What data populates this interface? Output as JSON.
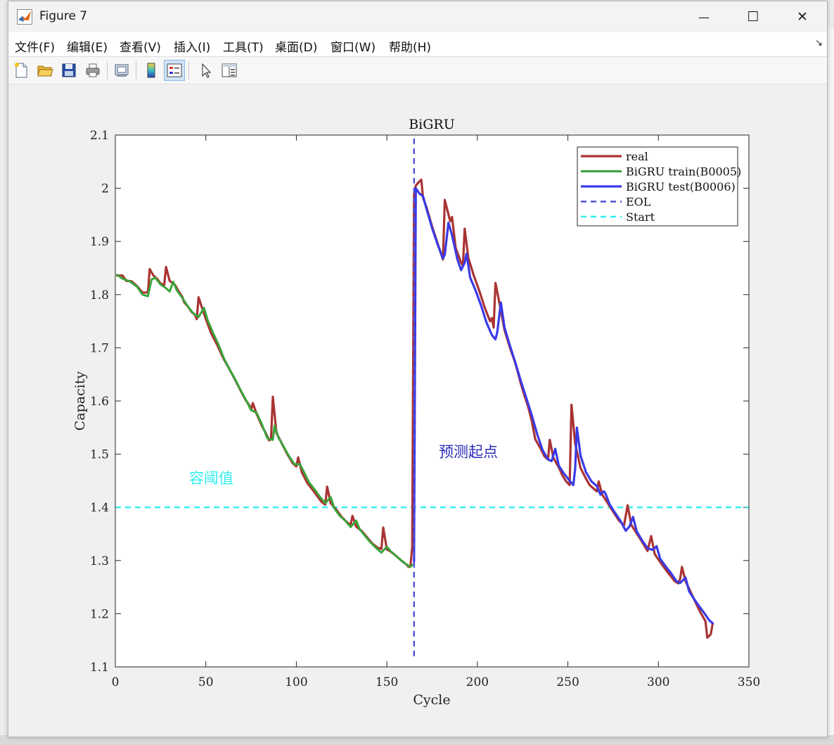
{
  "window": {
    "title": "Figure 7",
    "minimize_glyph": "—",
    "maximize_glyph": "☐",
    "close_glyph": "✕"
  },
  "menu": {
    "items": [
      "文件(F)",
      "编辑(E)",
      "查看(V)",
      "插入(I)",
      "工具(T)",
      "桌面(D)",
      "窗口(W)",
      "帮助(H)"
    ],
    "overflow_glyph": "↘"
  },
  "toolbar": {
    "icons": [
      "new-figure-icon",
      "open-file-icon",
      "save-icon",
      "print-icon",
      "link-plot-icon",
      "colorbar-icon",
      "legend-icon",
      "pointer-icon",
      "property-inspector-icon"
    ]
  },
  "colors": {
    "real": "#aa3333",
    "train": "#3aa33a",
    "test": "#3a3ae6",
    "eol": "#5050d8",
    "start": "#33eeee"
  },
  "chart_data": {
    "type": "line",
    "title": "BiGRU",
    "xlabel": "Cycle",
    "ylabel": "Capacity",
    "xlim": [
      0,
      350
    ],
    "ylim": [
      1.1,
      2.1
    ],
    "xticks": [
      0,
      50,
      100,
      150,
      200,
      250,
      300,
      350
    ],
    "yticks": [
      1.1,
      1.2,
      1.3,
      1.4,
      1.5,
      1.6,
      1.7,
      1.8,
      1.9,
      2.0,
      2.1
    ],
    "xtick_labels": [
      "0",
      "50",
      "100",
      "150",
      "200",
      "250",
      "300",
      "350"
    ],
    "ytick_labels": [
      "1.1",
      "1.2",
      "1.3",
      "1.4",
      "1.5",
      "1.6",
      "1.7",
      "1.8",
      "1.9",
      "2",
      "2.1"
    ],
    "legend_position": "top-right",
    "annotations": [
      {
        "text": "容阈值",
        "x": 53,
        "y": 1.445,
        "color": "#33eeee"
      },
      {
        "text": "预测起点",
        "x": 195,
        "y": 1.495,
        "color": "#2a2ab8"
      }
    ],
    "series": [
      {
        "name": "real",
        "style": "solid",
        "points": [
          [
            1,
            1.836
          ],
          [
            4,
            1.836
          ],
          [
            6,
            1.826
          ],
          [
            9,
            1.825
          ],
          [
            12,
            1.816
          ],
          [
            15,
            1.804
          ],
          [
            18,
            1.804
          ],
          [
            19,
            1.848
          ],
          [
            21,
            1.836
          ],
          [
            23,
            1.83
          ],
          [
            25,
            1.821
          ],
          [
            27,
            1.818
          ],
          [
            28,
            1.852
          ],
          [
            30,
            1.826
          ],
          [
            33,
            1.818
          ],
          [
            35,
            1.806
          ],
          [
            37,
            1.796
          ],
          [
            38,
            1.786
          ],
          [
            40,
            1.778
          ],
          [
            42,
            1.768
          ],
          [
            44,
            1.762
          ],
          [
            45,
            1.754
          ],
          [
            46,
            1.795
          ],
          [
            48,
            1.774
          ],
          [
            50,
            1.754
          ],
          [
            53,
            1.727
          ],
          [
            56,
            1.707
          ],
          [
            60,
            1.678
          ],
          [
            63,
            1.66
          ],
          [
            66,
            1.641
          ],
          [
            69,
            1.621
          ],
          [
            72,
            1.602
          ],
          [
            74,
            1.592
          ],
          [
            75,
            1.583
          ],
          [
            76,
            1.596
          ],
          [
            78,
            1.576
          ],
          [
            81,
            1.553
          ],
          [
            83,
            1.54
          ],
          [
            85,
            1.526
          ],
          [
            86,
            1.528
          ],
          [
            87,
            1.608
          ],
          [
            89,
            1.54
          ],
          [
            92,
            1.52
          ],
          [
            95,
            1.5
          ],
          [
            98,
            1.483
          ],
          [
            100,
            1.477
          ],
          [
            101,
            1.494
          ],
          [
            103,
            1.466
          ],
          [
            106,
            1.446
          ],
          [
            109,
            1.433
          ],
          [
            112,
            1.419
          ],
          [
            114,
            1.41
          ],
          [
            116,
            1.405
          ],
          [
            117,
            1.439
          ],
          [
            119,
            1.408
          ],
          [
            122,
            1.396
          ],
          [
            125,
            1.382
          ],
          [
            128,
            1.372
          ],
          [
            130,
            1.367
          ],
          [
            131,
            1.384
          ],
          [
            133,
            1.364
          ],
          [
            136,
            1.356
          ],
          [
            139,
            1.344
          ],
          [
            142,
            1.332
          ],
          [
            145,
            1.324
          ],
          [
            147,
            1.322
          ],
          [
            148,
            1.362
          ],
          [
            150,
            1.321
          ],
          [
            152,
            1.317
          ],
          [
            155,
            1.309
          ],
          [
            158,
            1.3
          ],
          [
            161,
            1.292
          ],
          [
            162,
            1.288
          ],
          [
            163,
            1.29
          ],
          [
            164,
            1.325
          ],
          [
            165,
            1.99
          ],
          [
            166,
            2.005
          ],
          [
            168,
            2.013
          ],
          [
            169,
            2.016
          ],
          [
            170,
            1.982
          ],
          [
            172,
            1.963
          ],
          [
            175,
            1.928
          ],
          [
            178,
            1.897
          ],
          [
            181,
            1.866
          ],
          [
            182,
            1.978
          ],
          [
            185,
            1.938
          ],
          [
            186,
            1.946
          ],
          [
            188,
            1.888
          ],
          [
            191,
            1.86
          ],
          [
            192,
            1.854
          ],
          [
            193,
            1.924
          ],
          [
            195,
            1.869
          ],
          [
            198,
            1.836
          ],
          [
            201,
            1.808
          ],
          [
            204,
            1.776
          ],
          [
            207,
            1.75
          ],
          [
            208,
            1.756
          ],
          [
            209,
            1.738
          ],
          [
            210,
            1.822
          ],
          [
            212,
            1.788
          ],
          [
            215,
            1.733
          ],
          [
            218,
            1.7
          ],
          [
            221,
            1.671
          ],
          [
            224,
            1.633
          ],
          [
            226,
            1.61
          ],
          [
            228,
            1.59
          ],
          [
            230,
            1.563
          ],
          [
            232,
            1.528
          ],
          [
            235,
            1.51
          ],
          [
            237,
            1.496
          ],
          [
            239,
            1.49
          ],
          [
            240,
            1.527
          ],
          [
            242,
            1.493
          ],
          [
            245,
            1.475
          ],
          [
            247,
            1.46
          ],
          [
            249,
            1.449
          ],
          [
            251,
            1.442
          ],
          [
            252,
            1.593
          ],
          [
            254,
            1.52
          ],
          [
            257,
            1.474
          ],
          [
            260,
            1.454
          ],
          [
            262,
            1.442
          ],
          [
            264,
            1.436
          ],
          [
            266,
            1.43
          ],
          [
            267,
            1.449
          ],
          [
            269,
            1.424
          ],
          [
            272,
            1.408
          ],
          [
            275,
            1.392
          ],
          [
            278,
            1.376
          ],
          [
            281,
            1.366
          ],
          [
            283,
            1.404
          ],
          [
            285,
            1.367
          ],
          [
            288,
            1.351
          ],
          [
            291,
            1.335
          ],
          [
            294,
            1.318
          ],
          [
            296,
            1.346
          ],
          [
            298,
            1.312
          ],
          [
            301,
            1.297
          ],
          [
            304,
            1.283
          ],
          [
            307,
            1.27
          ],
          [
            309,
            1.261
          ],
          [
            311,
            1.257
          ],
          [
            312,
            1.266
          ],
          [
            313,
            1.288
          ],
          [
            315,
            1.261
          ],
          [
            318,
            1.24
          ],
          [
            321,
            1.218
          ],
          [
            323,
            1.204
          ],
          [
            325,
            1.192
          ],
          [
            326,
            1.186
          ],
          [
            327,
            1.155
          ],
          [
            328,
            1.158
          ],
          [
            329,
            1.162
          ],
          [
            330,
            1.182
          ]
        ]
      },
      {
        "name": "BiGRU train(B0005)",
        "style": "solid",
        "points": [
          [
            1,
            1.837
          ],
          [
            4,
            1.83
          ],
          [
            8,
            1.825
          ],
          [
            12,
            1.815
          ],
          [
            15,
            1.8
          ],
          [
            18,
            1.797
          ],
          [
            20,
            1.828
          ],
          [
            22,
            1.832
          ],
          [
            25,
            1.819
          ],
          [
            28,
            1.812
          ],
          [
            30,
            1.806
          ],
          [
            32,
            1.824
          ],
          [
            34,
            1.808
          ],
          [
            37,
            1.794
          ],
          [
            40,
            1.778
          ],
          [
            43,
            1.765
          ],
          [
            46,
            1.758
          ],
          [
            49,
            1.775
          ],
          [
            51,
            1.752
          ],
          [
            54,
            1.728
          ],
          [
            57,
            1.706
          ],
          [
            60,
            1.68
          ],
          [
            63,
            1.66
          ],
          [
            66,
            1.642
          ],
          [
            69,
            1.622
          ],
          [
            72,
            1.603
          ],
          [
            75,
            1.583
          ],
          [
            78,
            1.578
          ],
          [
            81,
            1.556
          ],
          [
            84,
            1.53
          ],
          [
            87,
            1.527
          ],
          [
            88,
            1.554
          ],
          [
            90,
            1.532
          ],
          [
            93,
            1.514
          ],
          [
            96,
            1.496
          ],
          [
            99,
            1.481
          ],
          [
            102,
            1.481
          ],
          [
            104,
            1.468
          ],
          [
            107,
            1.447
          ],
          [
            110,
            1.434
          ],
          [
            113,
            1.42
          ],
          [
            116,
            1.408
          ],
          [
            119,
            1.419
          ],
          [
            121,
            1.398
          ],
          [
            124,
            1.384
          ],
          [
            127,
            1.375
          ],
          [
            130,
            1.363
          ],
          [
            133,
            1.375
          ],
          [
            135,
            1.359
          ],
          [
            138,
            1.346
          ],
          [
            141,
            1.334
          ],
          [
            144,
            1.324
          ],
          [
            147,
            1.315
          ],
          [
            150,
            1.326
          ],
          [
            152,
            1.318
          ],
          [
            155,
            1.309
          ],
          [
            158,
            1.3
          ],
          [
            161,
            1.292
          ],
          [
            163,
            1.288
          ],
          [
            164,
            1.292
          ]
        ]
      },
      {
        "name": "BiGRU test(B0006)",
        "style": "solid",
        "points": [
          [
            165,
            1.298
          ],
          [
            166,
            2.0
          ],
          [
            168,
            1.99
          ],
          [
            170,
            1.985
          ],
          [
            172,
            1.96
          ],
          [
            175,
            1.925
          ],
          [
            178,
            1.895
          ],
          [
            181,
            1.868
          ],
          [
            182,
            1.875
          ],
          [
            184,
            1.935
          ],
          [
            186,
            1.912
          ],
          [
            189,
            1.866
          ],
          [
            191,
            1.846
          ],
          [
            193,
            1.86
          ],
          [
            194,
            1.877
          ],
          [
            196,
            1.832
          ],
          [
            199,
            1.808
          ],
          [
            202,
            1.78
          ],
          [
            205,
            1.748
          ],
          [
            208,
            1.724
          ],
          [
            210,
            1.716
          ],
          [
            211,
            1.73
          ],
          [
            213,
            1.785
          ],
          [
            215,
            1.738
          ],
          [
            218,
            1.704
          ],
          [
            221,
            1.672
          ],
          [
            224,
            1.638
          ],
          [
            227,
            1.606
          ],
          [
            230,
            1.574
          ],
          [
            233,
            1.538
          ],
          [
            236,
            1.508
          ],
          [
            239,
            1.49
          ],
          [
            241,
            1.487
          ],
          [
            243,
            1.51
          ],
          [
            245,
            1.478
          ],
          [
            248,
            1.463
          ],
          [
            251,
            1.45
          ],
          [
            253,
            1.442
          ],
          [
            254,
            1.472
          ],
          [
            255,
            1.55
          ],
          [
            257,
            1.497
          ],
          [
            260,
            1.466
          ],
          [
            263,
            1.449
          ],
          [
            266,
            1.44
          ],
          [
            268,
            1.424
          ],
          [
            269,
            1.428
          ],
          [
            270,
            1.43
          ],
          [
            271,
            1.424
          ],
          [
            273,
            1.406
          ],
          [
            276,
            1.39
          ],
          [
            279,
            1.375
          ],
          [
            282,
            1.356
          ],
          [
            284,
            1.364
          ],
          [
            286,
            1.382
          ],
          [
            288,
            1.355
          ],
          [
            291,
            1.338
          ],
          [
            294,
            1.323
          ],
          [
            297,
            1.32
          ],
          [
            299,
            1.327
          ],
          [
            301,
            1.303
          ],
          [
            304,
            1.289
          ],
          [
            307,
            1.276
          ],
          [
            310,
            1.261
          ],
          [
            312,
            1.258
          ],
          [
            315,
            1.268
          ],
          [
            317,
            1.242
          ],
          [
            320,
            1.226
          ],
          [
            323,
            1.212
          ],
          [
            326,
            1.198
          ],
          [
            328,
            1.188
          ],
          [
            330,
            1.182
          ]
        ]
      },
      {
        "name": "EOL",
        "style": "dashed",
        "points": [
          [
            165,
            1.12
          ],
          [
            165,
            2.1
          ]
        ]
      },
      {
        "name": "Start",
        "style": "dashed",
        "points": [
          [
            0,
            1.4
          ],
          [
            350,
            1.4
          ]
        ]
      }
    ]
  }
}
